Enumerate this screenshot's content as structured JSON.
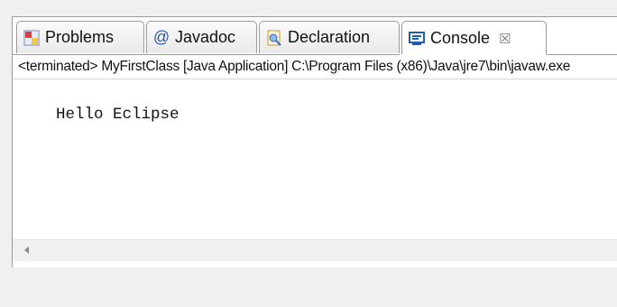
{
  "tabs": [
    {
      "label": "Problems",
      "icon": "problems-icon",
      "active": false
    },
    {
      "label": "Javadoc",
      "icon": "javadoc-icon",
      "active": false
    },
    {
      "label": "Declaration",
      "icon": "declaration-icon",
      "active": false
    },
    {
      "label": "Console",
      "icon": "console-icon",
      "active": true,
      "close_glyph": "☒"
    }
  ],
  "status_text": "<terminated> MyFirstClass [Java Application] C:\\Program Files (x86)\\Java\\jre7\\bin\\javaw.exe",
  "console_output": "Hello Eclipse",
  "colors": {
    "border": "#9a9a9a",
    "panel_bg": "#ffffff",
    "window_bg": "#f0f0f0",
    "console_icon_blue": "#1f5fb8"
  }
}
